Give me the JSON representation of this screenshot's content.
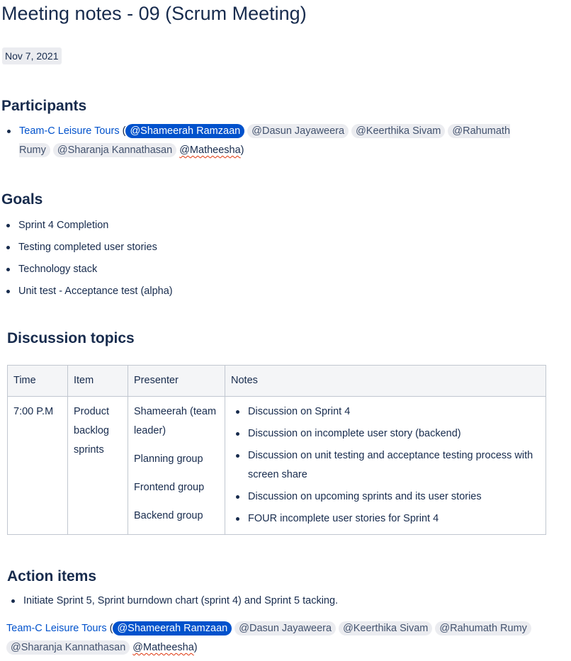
{
  "page": {
    "title": "Meeting notes - 09 (Scrum Meeting)",
    "date": "Nov 7, 2021"
  },
  "participants": {
    "heading": "Participants",
    "team_link": "Team-C Leisure Tours",
    "open_paren": " (",
    "close_paren": ")",
    "mentions": [
      "@Shameerah Ramzaan",
      "@Dasun Jayaweera",
      "@Keerthika Sivam",
      "@Rahumath Rumy",
      "@Sharanja Kannathasan",
      "@Matheesha"
    ]
  },
  "goals": {
    "heading": "Goals",
    "items": [
      "Sprint 4 Completion",
      "Testing completed user stories",
      "Technology stack",
      "Unit test - Acceptance test (alpha)"
    ]
  },
  "discussion": {
    "heading": "Discussion topics",
    "columns": [
      "Time",
      "Item",
      "Presenter",
      "Notes"
    ],
    "row": {
      "time": "7:00 P.M",
      "item": "Product backlog sprints",
      "presenters": [
        "Shameerah (team leader)",
        "Planning group",
        "Frontend group",
        "Backend group"
      ],
      "notes": [
        "Discussion on Sprint 4",
        "Discussion on incomplete user story (backend)",
        "Discussion on unit testing and acceptance testing process with screen share",
        "Discussion on upcoming sprints and its user stories",
        "FOUR incomplete user stories for Sprint 4"
      ]
    }
  },
  "actions": {
    "heading": "Action items",
    "items": [
      "Initiate Sprint 5, Sprint burndown chart (sprint 4) and Sprint 5 tacking."
    ],
    "team_link": "Team-C Leisure Tours",
    "open_paren": " (",
    "close_paren": ")",
    "mentions": [
      "@Shameerah Ramzaan",
      "@Dasun Jayaweera",
      "@Keerthika Sivam",
      "@Rahumath Rumy",
      "@Sharanja Kannathasan",
      "@Matheesha"
    ]
  },
  "colors": {
    "text": "#172b4d",
    "link": "#0052cc",
    "mention_bg": "#ebecf0",
    "mention_self_bg": "#0052cc"
  }
}
